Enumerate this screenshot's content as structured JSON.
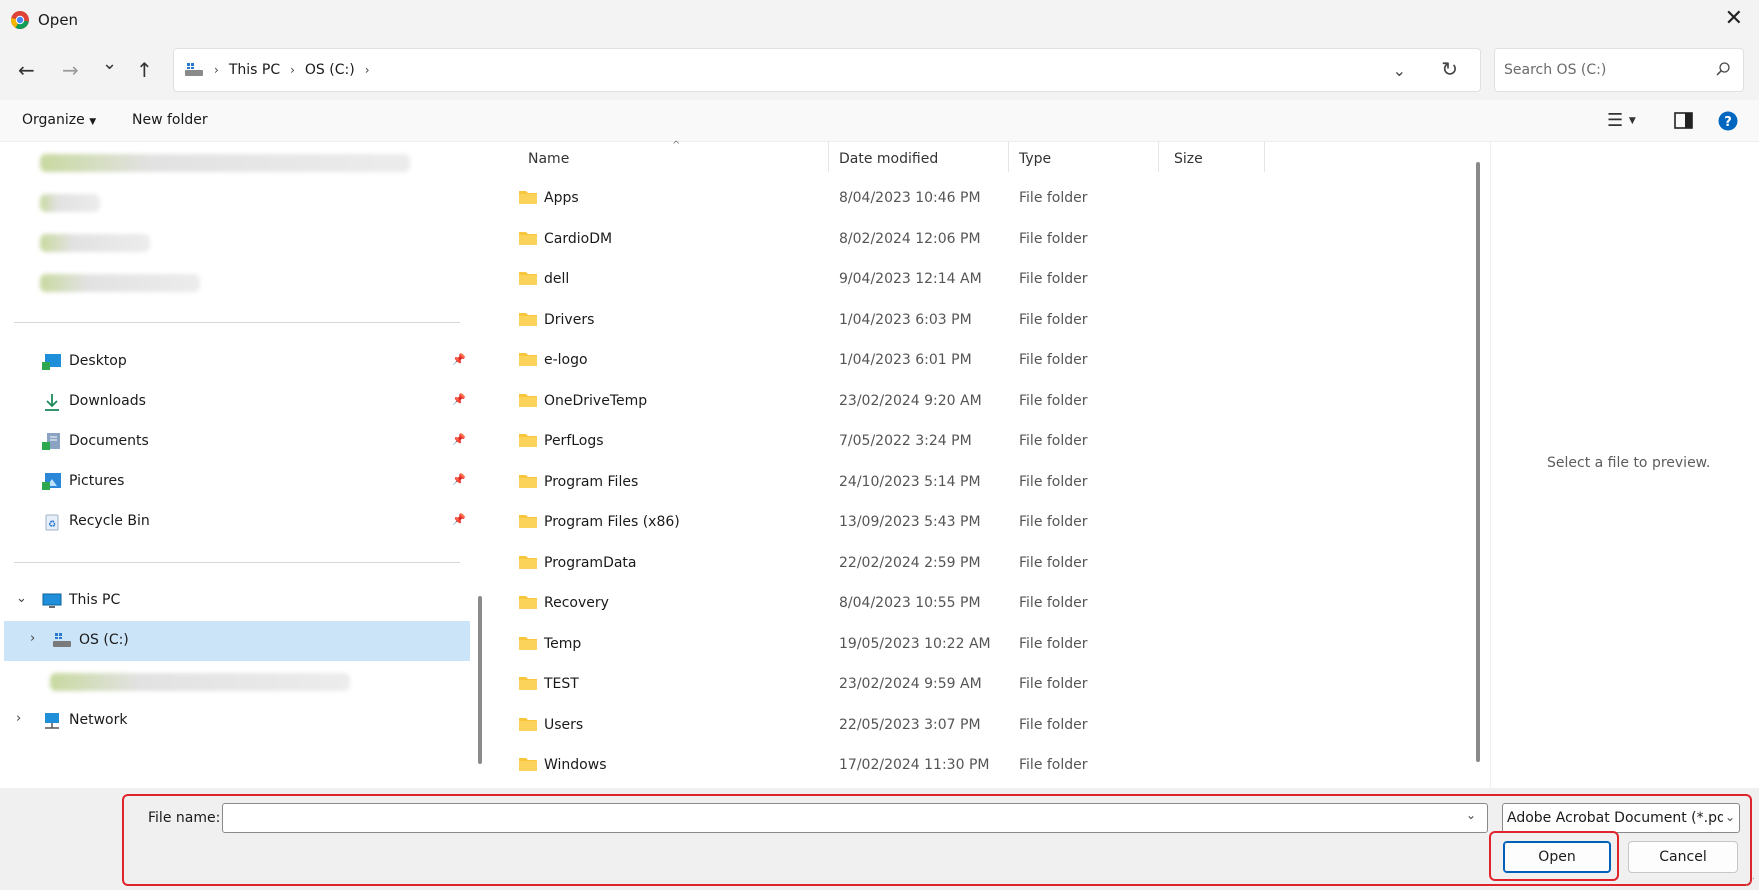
{
  "window": {
    "title": "Open",
    "close_glyph": "✕"
  },
  "nav": {
    "back": "←",
    "forward": "→",
    "recent": "⌄",
    "up": "↑",
    "breadcrumb": [
      "This PC",
      "OS (C:)"
    ],
    "search_placeholder": "Search OS (C:)"
  },
  "toolbar": {
    "organize": "Organize",
    "new_folder": "New folder"
  },
  "sidebar": {
    "quick_access": [
      {
        "label": "Desktop",
        "icon": "desktop-icon"
      },
      {
        "label": "Downloads",
        "icon": "download-icon"
      },
      {
        "label": "Documents",
        "icon": "documents-icon"
      },
      {
        "label": "Pictures",
        "icon": "pictures-icon"
      },
      {
        "label": "Recycle Bin",
        "icon": "recycle-bin-icon"
      }
    ],
    "this_pc": "This PC",
    "drive": "OS (C:)",
    "network": "Network"
  },
  "columns": {
    "name": "Name",
    "date": "Date modified",
    "type": "Type",
    "size": "Size"
  },
  "files": [
    {
      "name": "Apps",
      "date": "8/04/2023 10:46 PM",
      "type": "File folder"
    },
    {
      "name": "CardioDM",
      "date": "8/02/2024 12:06 PM",
      "type": "File folder"
    },
    {
      "name": "dell",
      "date": "9/04/2023 12:14 AM",
      "type": "File folder"
    },
    {
      "name": "Drivers",
      "date": "1/04/2023 6:03 PM",
      "type": "File folder"
    },
    {
      "name": "e-logo",
      "date": "1/04/2023 6:01 PM",
      "type": "File folder"
    },
    {
      "name": "OneDriveTemp",
      "date": "23/02/2024 9:20 AM",
      "type": "File folder"
    },
    {
      "name": "PerfLogs",
      "date": "7/05/2022 3:24 PM",
      "type": "File folder"
    },
    {
      "name": "Program Files",
      "date": "24/10/2023 5:14 PM",
      "type": "File folder"
    },
    {
      "name": "Program Files (x86)",
      "date": "13/09/2023 5:43 PM",
      "type": "File folder"
    },
    {
      "name": "ProgramData",
      "date": "22/02/2024 2:59 PM",
      "type": "File folder"
    },
    {
      "name": "Recovery",
      "date": "8/04/2023 10:55 PM",
      "type": "File folder"
    },
    {
      "name": "Temp",
      "date": "19/05/2023 10:22 AM",
      "type": "File folder"
    },
    {
      "name": "TEST",
      "date": "23/02/2024 9:59 AM",
      "type": "File folder"
    },
    {
      "name": "Users",
      "date": "22/05/2023 3:07 PM",
      "type": "File folder"
    },
    {
      "name": "Windows",
      "date": "17/02/2024 11:30 PM",
      "type": "File folder"
    }
  ],
  "preview": {
    "empty_text": "Select a file to preview."
  },
  "footer": {
    "file_name_label": "File name:",
    "file_name_value": "",
    "file_type": "Adobe Acrobat Document (*.pdf)",
    "open": "Open",
    "cancel": "Cancel"
  },
  "colors": {
    "accent": "#005fb8",
    "highlight": "#e0242c",
    "selected": "#cce4f7",
    "folder": "#f8c63d"
  }
}
